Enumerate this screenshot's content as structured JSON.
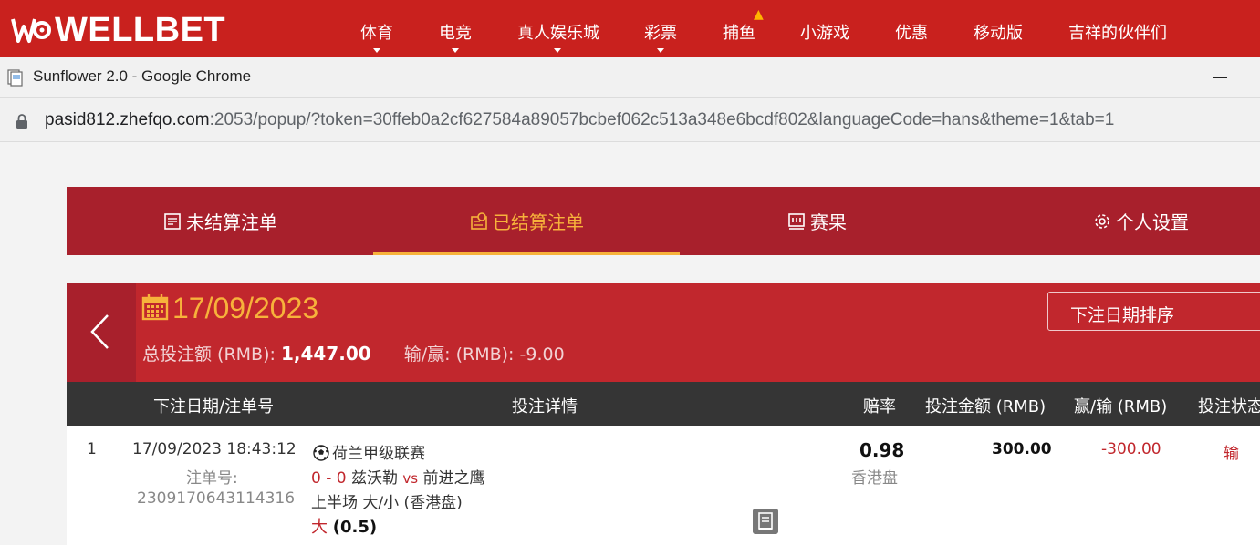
{
  "site": {
    "logo_text": "WELLBET",
    "nav": [
      {
        "label": "体育",
        "has_caret": true
      },
      {
        "label": "电竞",
        "has_caret": true
      },
      {
        "label": "真人娱乐城",
        "has_caret": true
      },
      {
        "label": "彩票",
        "has_caret": true
      },
      {
        "label": "捕鱼",
        "has_caret": false,
        "hot_icon": "flame-icon"
      },
      {
        "label": "小游戏",
        "has_caret": false
      },
      {
        "label": "优惠",
        "has_caret": false
      },
      {
        "label": "移动版",
        "has_caret": false
      },
      {
        "label": "吉祥的伙伴们",
        "has_caret": false
      }
    ]
  },
  "window": {
    "title": "Sunflower 2.0 - Google Chrome",
    "url_host": "pasid812.zhefqo.com",
    "url_rest": ":2053/popup/?token=30ffeb0a2cf627584a89057bcbef062c513a348e6bcdf802&languageCode=hans&theme=1&tab=1"
  },
  "tabs": [
    {
      "label": "未结算注单",
      "icon": "pending-bets-icon",
      "active": false
    },
    {
      "label": "已结算注单",
      "icon": "settled-bets-icon",
      "active": true
    },
    {
      "label": "赛果",
      "icon": "results-icon",
      "active": false
    },
    {
      "label": "个人设置",
      "icon": "gear-icon",
      "active": false
    }
  ],
  "summary": {
    "date": "17/09/2023",
    "total_stake_label": "总投注额 (RMB):",
    "total_stake_value": "1,447.00",
    "win_loss_label": "输/赢: (RMB):",
    "win_loss_value": "-9.00",
    "sort_label": "下注日期排序"
  },
  "table": {
    "headers": [
      "下注日期/注单号",
      "投注详情",
      "赔率",
      "投注金额 (RMB)",
      "赢/输 (RMB)",
      "投注状态"
    ],
    "rows": [
      {
        "index": "1",
        "datetime": "17/09/2023 18:43:12",
        "ticket_label": "注单号:",
        "ticket_no": "2309170643114316",
        "league": "荷兰甲级联赛",
        "score": "0 - 0",
        "home": "兹沃勒",
        "vs": "vs",
        "away": "前进之鹰",
        "market": "上半场 大/小 (香港盘)",
        "selection": "大",
        "selection_line": "(0.5)",
        "odds": "0.98",
        "odds_type": "香港盘",
        "stake": "300.00",
        "win_loss": "-300.00",
        "status": "输"
      }
    ]
  },
  "colors": {
    "brand_red": "#c9211e",
    "tab_bg": "#a8202c",
    "summary_bg": "#c1272d",
    "accent_gold": "#f7b23b",
    "table_header_bg": "#353535"
  }
}
